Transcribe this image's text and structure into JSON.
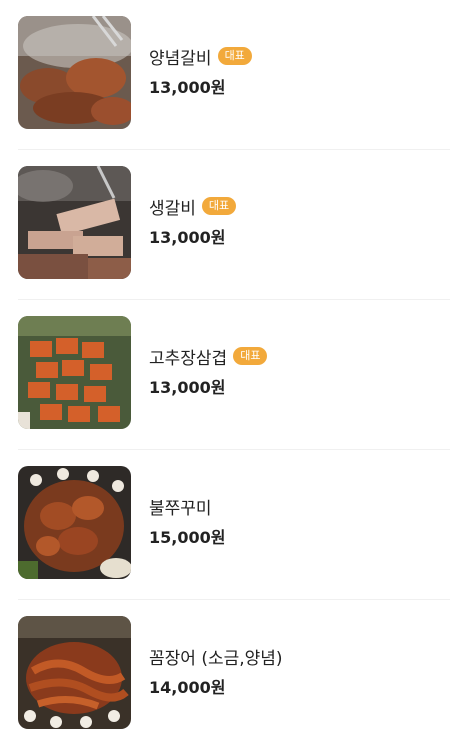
{
  "menu": {
    "items": [
      {
        "name": "양념갈비",
        "price": "13,000원",
        "badge": "대표",
        "image": "marinated-galbi-photo"
      },
      {
        "name": "생갈비",
        "price": "13,000원",
        "badge": "대표",
        "image": "raw-galbi-photo"
      },
      {
        "name": "고추장삼겹",
        "price": "13,000원",
        "badge": "대표",
        "image": "gochujang-samgyeop-photo"
      },
      {
        "name": "불쭈꾸미",
        "price": "15,000원",
        "image": "spicy-webfoot-octopus-photo"
      },
      {
        "name": "꼼장어 (소금,양념)",
        "price": "14,000원",
        "image": "hagfish-photo"
      }
    ]
  },
  "colors": {
    "badge": "#f2a93b",
    "divider": "#f0f0f0",
    "text": "#222222"
  }
}
